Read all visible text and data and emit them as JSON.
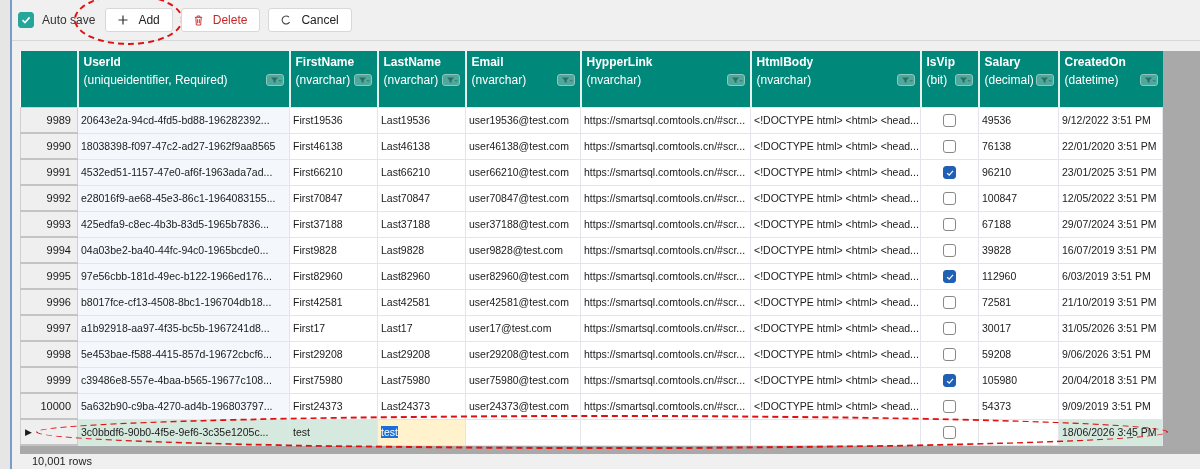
{
  "toolbar": {
    "auto_save": {
      "label": "Auto save",
      "checked": true
    },
    "buttons": [
      {
        "label": "Add",
        "kind": "add",
        "circled": true
      },
      {
        "label": "Delete",
        "kind": "delete",
        "circled": false
      },
      {
        "label": "Cancel",
        "kind": "cancel",
        "circled": false
      }
    ]
  },
  "table": {
    "columns": [
      {
        "title": "UserId",
        "type": "(uniqueidentifier, Required)",
        "kind": "text"
      },
      {
        "title": "FirstName",
        "type": "(nvarchar)",
        "kind": "text"
      },
      {
        "title": "LastName",
        "type": "(nvarchar)",
        "kind": "text"
      },
      {
        "title": "Email",
        "type": "(nvarchar)",
        "kind": "text"
      },
      {
        "title": "HypperLink",
        "type": "(nvarchar)",
        "kind": "text"
      },
      {
        "title": "HtmlBody",
        "type": "(nvarchar)",
        "kind": "text"
      },
      {
        "title": "IsVip",
        "type": "(bit)",
        "kind": "check"
      },
      {
        "title": "Salary",
        "type": "(decimal)",
        "kind": "text"
      },
      {
        "title": "CreatedOn",
        "type": "(datetime)",
        "kind": "text"
      }
    ],
    "rows": [
      {
        "num": "9989",
        "cells": [
          "20643e2a-94cd-4fd5-bd88-196282392...",
          "First19536",
          "Last19536",
          "user19536@test.com",
          "https://smartsql.comtools.cn/#scr...",
          "<!DOCTYPE html> <html> <head...",
          false,
          "49536",
          "9/12/2022 3:51 PM"
        ]
      },
      {
        "num": "9990",
        "cells": [
          "18038398-f097-47c2-ad27-1962f9aa8565",
          "First46138",
          "Last46138",
          "user46138@test.com",
          "https://smartsql.comtools.cn/#scr...",
          "<!DOCTYPE html> <html> <head...",
          false,
          "76138",
          "22/01/2020 3:51 PM"
        ]
      },
      {
        "num": "9991",
        "cells": [
          "4532ed51-1157-47e0-af6f-1963ada7ad...",
          "First66210",
          "Last66210",
          "user66210@test.com",
          "https://smartsql.comtools.cn/#scr...",
          "<!DOCTYPE html> <html> <head...",
          true,
          "96210",
          "23/01/2025 3:51 PM"
        ]
      },
      {
        "num": "9992",
        "cells": [
          "e28016f9-ae68-45e3-86c1-1964083155...",
          "First70847",
          "Last70847",
          "user70847@test.com",
          "https://smartsql.comtools.cn/#scr...",
          "<!DOCTYPE html> <html> <head...",
          false,
          "100847",
          "12/05/2022 3:51 PM"
        ]
      },
      {
        "num": "9993",
        "cells": [
          "425edfa9-c8ec-4b3b-83d5-1965b7836...",
          "First37188",
          "Last37188",
          "user37188@test.com",
          "https://smartsql.comtools.cn/#scr...",
          "<!DOCTYPE html> <html> <head...",
          false,
          "67188",
          "29/07/2024 3:51 PM"
        ]
      },
      {
        "num": "9994",
        "cells": [
          "04a03be2-ba40-44fc-94c0-1965bcde0...",
          "First9828",
          "Last9828",
          "user9828@test.com",
          "https://smartsql.comtools.cn/#scr...",
          "<!DOCTYPE html> <html> <head...",
          false,
          "39828",
          "16/07/2019 3:51 PM"
        ]
      },
      {
        "num": "9995",
        "cells": [
          "97e56cbb-181d-49ec-b122-1966ed176...",
          "First82960",
          "Last82960",
          "user82960@test.com",
          "https://smartsql.comtools.cn/#scr...",
          "<!DOCTYPE html> <html> <head...",
          true,
          "112960",
          "6/03/2019 3:51 PM"
        ]
      },
      {
        "num": "9996",
        "cells": [
          "b8017fce-cf13-4508-8bc1-196704db18...",
          "First42581",
          "Last42581",
          "user42581@test.com",
          "https://smartsql.comtools.cn/#scr...",
          "<!DOCTYPE html> <html> <head...",
          false,
          "72581",
          "21/10/2019 3:51 PM"
        ]
      },
      {
        "num": "9997",
        "cells": [
          "a1b92918-aa97-4f35-bc5b-1967241d8...",
          "First17",
          "Last17",
          "user17@test.com",
          "https://smartsql.comtools.cn/#scr...",
          "<!DOCTYPE html> <html> <head...",
          false,
          "30017",
          "31/05/2026 3:51 PM"
        ]
      },
      {
        "num": "9998",
        "cells": [
          "5e453bae-f588-4415-857d-19672cbcf6...",
          "First29208",
          "Last29208",
          "user29208@test.com",
          "https://smartsql.comtools.cn/#scr...",
          "<!DOCTYPE html> <html> <head...",
          false,
          "59208",
          "9/06/2026 3:51 PM"
        ]
      },
      {
        "num": "9999",
        "cells": [
          "c39486e8-557e-4baa-b565-19677c108...",
          "First75980",
          "Last75980",
          "user75980@test.com",
          "https://smartsql.comtools.cn/#scr...",
          "<!DOCTYPE html> <html> <head...",
          true,
          "105980",
          "20/04/2018 3:51 PM"
        ]
      },
      {
        "num": "10000",
        "cells": [
          "5a632b90-c9ba-4270-ad4b-196803797...",
          "First24373",
          "Last24373",
          "user24373@test.com",
          "https://smartsql.comtools.cn/#scr...",
          "<!DOCTYPE html> <html> <head...",
          false,
          "54373",
          "9/09/2019 3:51 PM"
        ]
      }
    ],
    "new_row": {
      "marker": "▶",
      "circled": true,
      "cells": [
        {
          "text": "3c0bbdf6-90b0-4f5e-9ef6-3c35e1205c...",
          "filled": true,
          "editing": false
        },
        {
          "text": "test",
          "filled": true,
          "editing": false
        },
        {
          "text": "test",
          "filled": false,
          "editing": true
        },
        {
          "filled": false,
          "editing": false
        },
        {
          "filled": false,
          "editing": false
        },
        {
          "filled": false,
          "editing": false
        },
        {
          "checked": false,
          "filled": false,
          "editing": false
        },
        {
          "filled": false,
          "editing": false
        },
        {
          "text": "18/06/2026 3:45 PM",
          "filled": true,
          "editing": false
        }
      ]
    }
  },
  "status_bar": {
    "text": "10,001 rows"
  }
}
